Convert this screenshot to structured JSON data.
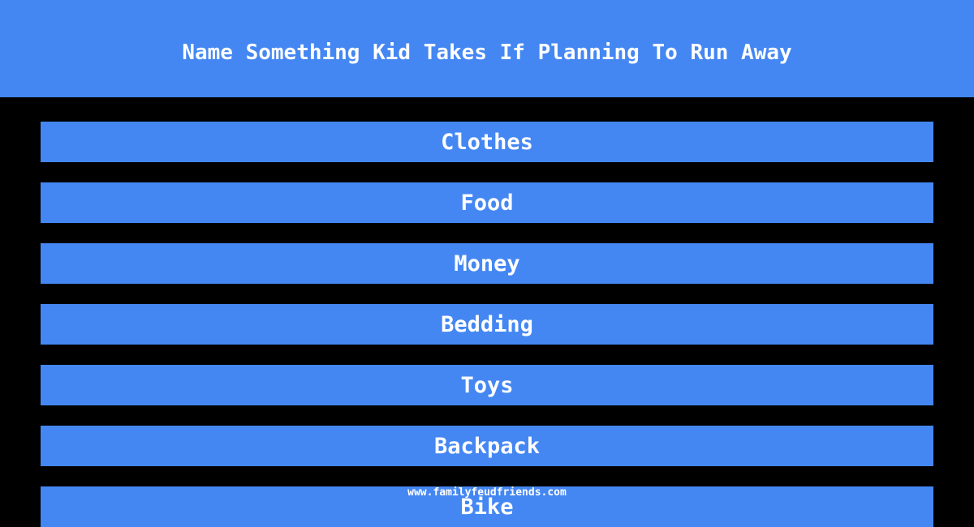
{
  "header": {
    "title": "Name Something Kid Takes If Planning To Run Away"
  },
  "answers": [
    {
      "label": "Clothes"
    },
    {
      "label": "Food"
    },
    {
      "label": "Money"
    },
    {
      "label": "Bedding"
    },
    {
      "label": "Toys"
    },
    {
      "label": "Backpack"
    },
    {
      "label": "Bike"
    }
  ],
  "footer": {
    "watermark": "www.familyfeudfriends.com"
  },
  "colors": {
    "accent": "#4487F3",
    "background": "#000000",
    "text": "#ffffff"
  }
}
